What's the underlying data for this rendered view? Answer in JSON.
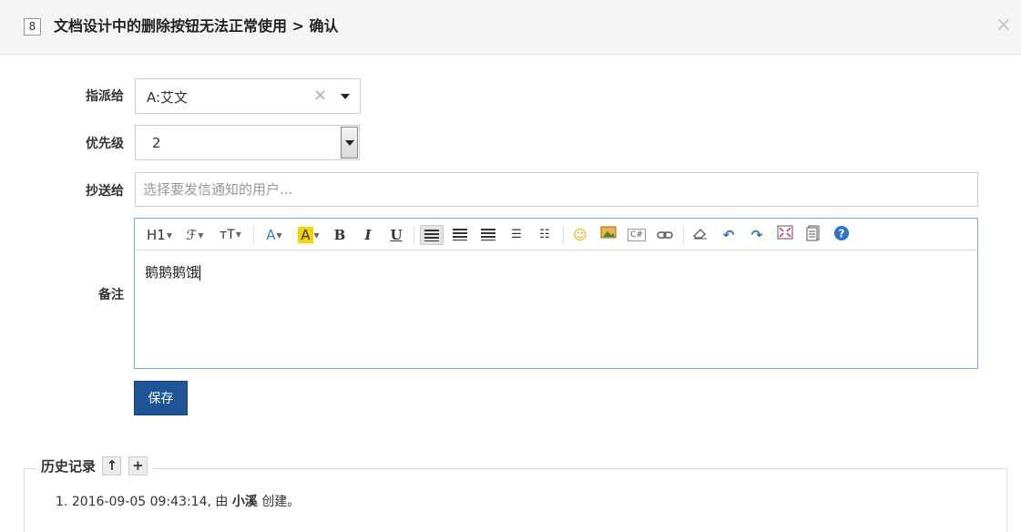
{
  "header": {
    "issue_id": "8",
    "title": "文档设计中的删除按钮无法正常使用 > 确认",
    "close_label": "×"
  },
  "form": {
    "assign_label": "指派给",
    "assign_value": "A:艾文",
    "priority_label": "优先级",
    "priority_value": "2",
    "cc_label": "抄送给",
    "cc_placeholder": "选择要发信通知的用户...",
    "notes_label": "备注",
    "notes_content": "鹅鹅鹅饿",
    "save_label": "保存"
  },
  "toolbar": {
    "heading": "H1",
    "font_family": "ℱ",
    "font_size": "тT",
    "font_color": "A",
    "bg_color": "A",
    "bold": "B",
    "italic": "I",
    "underline": "U",
    "icons": [
      "align-left-icon",
      "align-center-icon",
      "align-right-icon",
      "ordered-list-icon",
      "unordered-list-icon",
      "emoticon-icon",
      "image-icon",
      "code-icon",
      "link-icon",
      "eraser-icon",
      "undo-icon",
      "redo-icon",
      "fullscreen-icon",
      "source-icon",
      "help-icon"
    ]
  },
  "history": {
    "title": "历史记录",
    "up_label": "↑",
    "add_label": "+",
    "entry": {
      "index": "1.",
      "prefix": "2016-09-05 09:43:14, 由",
      "user": "小溪",
      "suffix": "创建。"
    }
  }
}
